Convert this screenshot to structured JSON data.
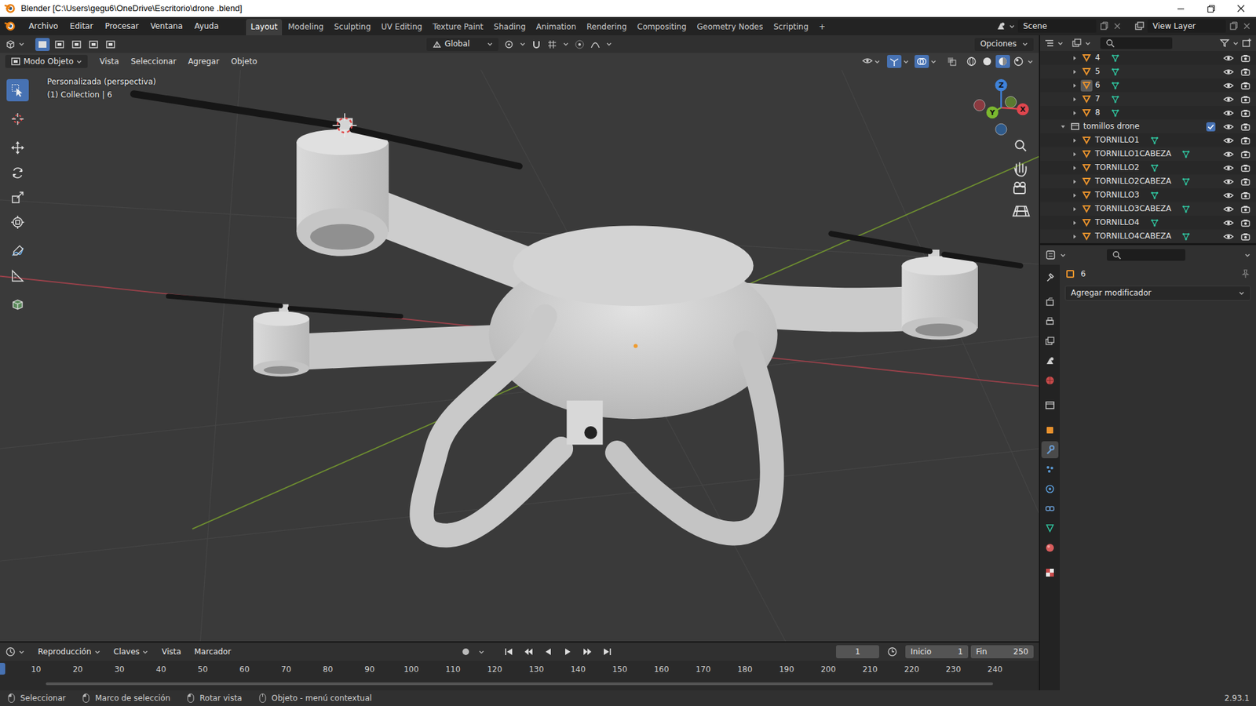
{
  "window": {
    "title": "Blender [C:\\Users\\gegu6\\OneDrive\\Escritorio\\drone .blend]"
  },
  "menu": [
    "Archivo",
    "Editar",
    "Procesar",
    "Ventana",
    "Ayuda"
  ],
  "workspaces": [
    {
      "label": "Layout",
      "selected": true
    },
    {
      "label": "Modeling",
      "selected": false
    },
    {
      "label": "Sculpting",
      "selected": false
    },
    {
      "label": "UV Editing",
      "selected": false
    },
    {
      "label": "Texture Paint",
      "selected": false
    },
    {
      "label": "Shading",
      "selected": false
    },
    {
      "label": "Animation",
      "selected": false
    },
    {
      "label": "Rendering",
      "selected": false
    },
    {
      "label": "Compositing",
      "selected": false
    },
    {
      "label": "Geometry Nodes",
      "selected": false
    },
    {
      "label": "Scripting",
      "selected": false
    }
  ],
  "add_workspace": "+",
  "scene": "Scene",
  "view_layer": "View Layer",
  "viewport": {
    "transform": "Global",
    "options": "Opciones",
    "mode": "Modo Objeto",
    "menu": [
      "Vista",
      "Seleccionar",
      "Agregar",
      "Objeto"
    ],
    "view_name": "Personalizada (perspectiva)",
    "collection_info": "(1) Collection | 6",
    "axes": [
      "X",
      "Y",
      "Z"
    ],
    "tools": [
      {
        "kind": "select",
        "selected": true
      },
      {
        "kind": "cursor",
        "selected": false
      },
      {
        "kind": "move",
        "selected": false
      },
      {
        "kind": "rotate",
        "selected": false
      },
      {
        "kind": "scale",
        "selected": false
      },
      {
        "kind": "transform",
        "selected": false
      },
      {
        "kind": "annotate",
        "selected": false
      },
      {
        "kind": "measure",
        "selected": false
      },
      {
        "kind": "add",
        "selected": false
      }
    ],
    "shading": [
      {
        "kind": "wireframe",
        "selected": false
      },
      {
        "kind": "solid",
        "selected": false
      },
      {
        "kind": "material",
        "selected": true
      },
      {
        "kind": "rendered",
        "selected": false
      }
    ]
  },
  "outliner": {
    "items": [
      {
        "label": "4",
        "kind": "object",
        "expanded": false,
        "selected": false
      },
      {
        "label": "5",
        "kind": "object",
        "expanded": false,
        "selected": false
      },
      {
        "label": "6",
        "kind": "object",
        "expanded": false,
        "selected": true
      },
      {
        "label": "7",
        "kind": "object",
        "expanded": false,
        "selected": false
      },
      {
        "label": "8",
        "kind": "object",
        "expanded": false,
        "selected": false
      },
      {
        "label": "tomillos drone",
        "kind": "collection",
        "expanded": true,
        "selected": false,
        "checked": true
      },
      {
        "label": "TORNILLO1",
        "kind": "object",
        "expanded": false,
        "selected": false
      },
      {
        "label": "TORNILLO1CABEZA",
        "kind": "object",
        "expanded": false,
        "selected": false
      },
      {
        "label": "TORNILLO2",
        "kind": "object",
        "expanded": false,
        "selected": false
      },
      {
        "label": "TORNILLO2CABEZA",
        "kind": "object",
        "expanded": false,
        "selected": false
      },
      {
        "label": "TORNILLO3",
        "kind": "object",
        "expanded": false,
        "selected": false
      },
      {
        "label": "TORNILLO3CABEZA",
        "kind": "object",
        "expanded": false,
        "selected": false
      },
      {
        "label": "TORNILLO4",
        "kind": "object",
        "expanded": false,
        "selected": false
      },
      {
        "label": "TORNILLO4CABEZA",
        "kind": "object",
        "expanded": false,
        "selected": false
      }
    ]
  },
  "properties": {
    "object": "6",
    "add_modifier": "Agregar modificador",
    "tabs": [
      {
        "kind": "tool",
        "selected": false
      },
      {
        "kind": "render",
        "selected": false
      },
      {
        "kind": "output",
        "selected": false
      },
      {
        "kind": "viewlayer",
        "selected": false
      },
      {
        "kind": "scene",
        "selected": false
      },
      {
        "kind": "world",
        "selected": false
      },
      {
        "kind": "collection",
        "selected": false
      },
      {
        "kind": "object",
        "selected": false
      },
      {
        "kind": "modifiers",
        "selected": true
      },
      {
        "kind": "particles",
        "selected": false
      },
      {
        "kind": "physics",
        "selected": false
      },
      {
        "kind": "constraints",
        "selected": false
      },
      {
        "kind": "data",
        "selected": false
      },
      {
        "kind": "material",
        "selected": false
      },
      {
        "kind": "texture",
        "selected": false
      }
    ]
  },
  "timeline": {
    "menu": [
      "Reproducción",
      "Claves",
      "Vista",
      "Marcador"
    ],
    "frame": "1",
    "start_label": "Inicio",
    "start": "1",
    "end_label": "Fin",
    "end": "250",
    "ticks": [
      "10",
      "20",
      "30",
      "40",
      "50",
      "60",
      "70",
      "80",
      "90",
      "100",
      "110",
      "120",
      "130",
      "140",
      "150",
      "160",
      "170",
      "180",
      "190",
      "200",
      "210",
      "220",
      "230",
      "240"
    ]
  },
  "status_bar": {
    "items": [
      "Seleccionar",
      "Marco de selección",
      "Rotar vista",
      "Objeto - menú contextual"
    ],
    "version": "2.93.1"
  }
}
